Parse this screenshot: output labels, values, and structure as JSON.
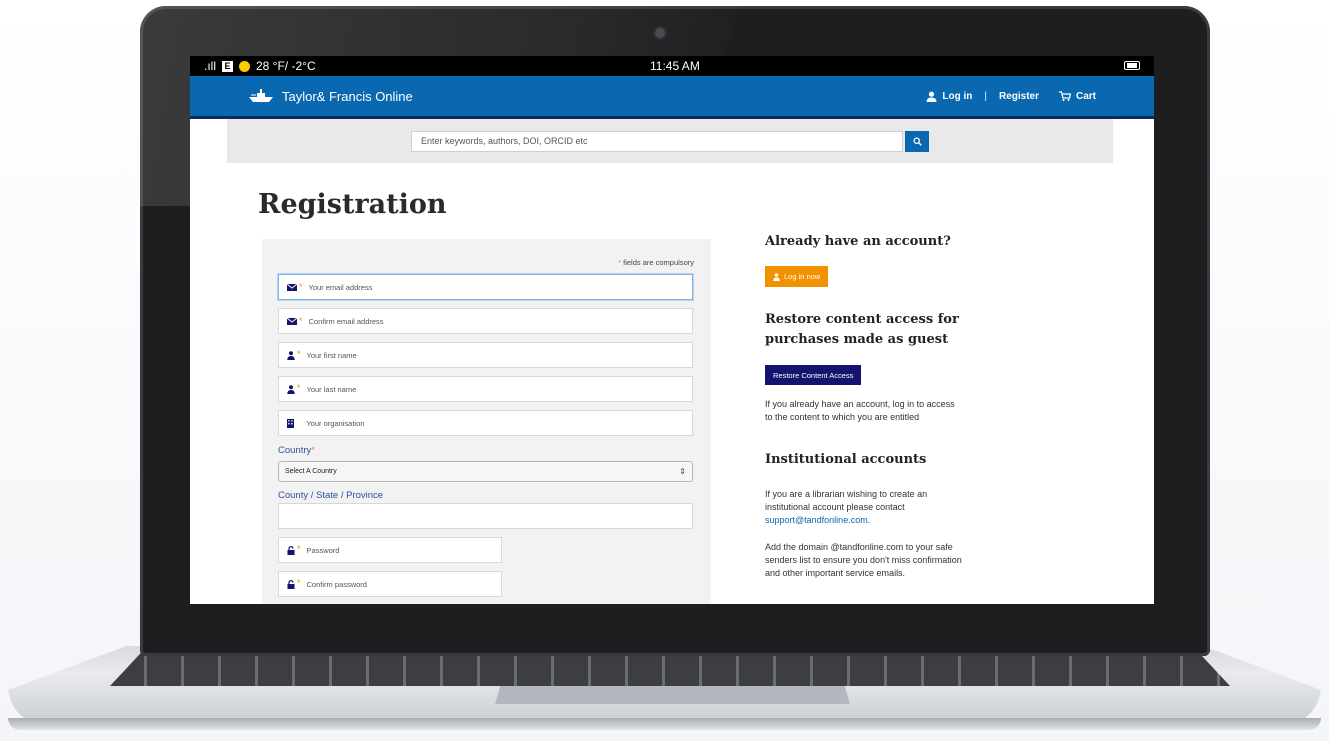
{
  "status_bar": {
    "signal": ".ıll",
    "e_badge": "E",
    "weather": "28 °F/ -2°C",
    "time": "11:45 AM"
  },
  "header": {
    "brand": "Taylor& Francis Online",
    "login": "Log in",
    "separator": "|",
    "register": "Register",
    "cart": "Cart",
    "brand_color": "#0a68b0"
  },
  "search": {
    "placeholder": "Enter keywords, authors, DOI, ORCID etc"
  },
  "page": {
    "title": "Registration"
  },
  "form": {
    "compulsory_note": "fields are compulsory",
    "compulsory_star": "*",
    "email_placeholder": "Your email address",
    "confirm_email_placeholder": "Confirm email address",
    "first_name_placeholder": "Your first name",
    "last_name_placeholder": "Your last name",
    "organisation_placeholder": "Your organisation",
    "country_label": "Country",
    "country_selected": "Select A Country",
    "region_label": "County / State / Province",
    "password_placeholder": "Password",
    "confirm_password_placeholder": "Confirm password"
  },
  "sidebar": {
    "have_account_heading": "Already have an account?",
    "login_now_button": "Log in now",
    "restore_heading": "Restore content access for purchases made as guest",
    "restore_button": "Restore Content Access",
    "restore_text": "If you already have an account, log in to access to the content to which you are entitled",
    "institutional_heading": "Institutional accounts",
    "institutional_text": "If you are a librarian wishing to create an institutional account please contact",
    "support_email": "support@tandfonline.com",
    "period": ".",
    "safe_senders_text": "Add the domain @tandfonline.com to your safe senders list to ensure you don't miss confirmation and other important service emails."
  },
  "colors": {
    "accent_orange": "#f39200",
    "navy_button": "#14146e",
    "label_blue": "#2f4f9f"
  }
}
